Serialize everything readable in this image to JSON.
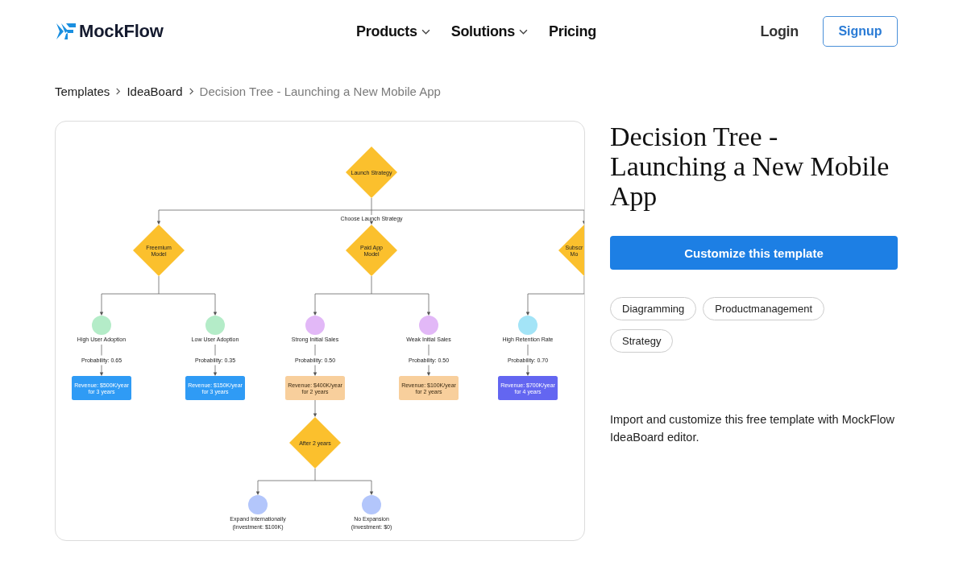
{
  "header": {
    "logo": "MockFlow",
    "nav": [
      {
        "label": "Products",
        "dropdown": true
      },
      {
        "label": "Solutions",
        "dropdown": true
      },
      {
        "label": "Pricing",
        "dropdown": false
      }
    ],
    "login": "Login",
    "signup": "Signup"
  },
  "breadcrumb": [
    {
      "label": "Templates",
      "current": false
    },
    {
      "label": "IdeaBoard",
      "current": false
    },
    {
      "label": "Decision Tree - Launching a New Mobile App",
      "current": true
    }
  ],
  "preview": {
    "diagram": {
      "kind": "decision",
      "lines": [
        "Launch Strategy"
      ],
      "edge_label": "Choose Launch Strategy",
      "children": [
        {
          "kind": "decision",
          "lines": [
            "Freemium",
            "Model"
          ],
          "children": [
            {
              "kind": "chance",
              "color": "#b4ecc8",
              "lines": [
                "High User Adoption"
              ],
              "edge_label": "Probability: 0.65",
              "children": [
                {
                  "kind": "outcome",
                  "color": "#2f9bf5",
                  "lines": [
                    "Revenue: $500K/year",
                    "for 3 years"
                  ]
                }
              ]
            },
            {
              "kind": "chance",
              "color": "#b4ecc8",
              "lines": [
                "Low User Adoption"
              ],
              "edge_label": "Probability: 0.35",
              "children": [
                {
                  "kind": "outcome",
                  "color": "#2f9bf5",
                  "lines": [
                    "Revenue: $150K/year",
                    "for 3 years"
                  ]
                }
              ]
            }
          ]
        },
        {
          "kind": "decision",
          "lines": [
            "Paid App",
            "Model"
          ],
          "children": [
            {
              "kind": "chance",
              "color": "#e2b8f7",
              "lines": [
                "Strong Initial Sales"
              ],
              "edge_label": "Probability: 0.50",
              "children": [
                {
                  "kind": "outcome",
                  "color": "#f8cf9c",
                  "lines": [
                    "Revenue: $400K/year",
                    "for 2 years"
                  ],
                  "children": [
                    {
                      "kind": "decision",
                      "lines": [
                        "After 2 years"
                      ],
                      "children": [
                        {
                          "kind": "chance",
                          "color": "#b3c6fb",
                          "lines": [
                            "Expand Internationally",
                            "(Investment: $100K)"
                          ]
                        },
                        {
                          "kind": "chance",
                          "color": "#b3c6fb",
                          "lines": [
                            "No Expansion",
                            "(Investment: $0)"
                          ]
                        }
                      ]
                    }
                  ]
                }
              ]
            },
            {
              "kind": "chance",
              "color": "#e2b8f7",
              "lines": [
                "Weak Initial Sales"
              ],
              "edge_label": "Probability: 0.50",
              "children": [
                {
                  "kind": "outcome",
                  "color": "#f8cf9c",
                  "lines": [
                    "Revenue: $100K/year",
                    "for 2 years"
                  ]
                }
              ]
            }
          ]
        },
        {
          "kind": "decision",
          "lines": [
            "Subscr",
            "Mo"
          ],
          "children": [
            {
              "kind": "chance",
              "color": "#a3e4f7",
              "lines": [
                "High Retention Rate"
              ],
              "edge_label": "Probability: 0.70",
              "children": [
                {
                  "kind": "outcome",
                  "color": "#6366f1",
                  "lines": [
                    "Revenue: $700K/year",
                    "for 4 years"
                  ]
                }
              ]
            }
          ]
        }
      ]
    }
  },
  "details": {
    "title": "Decision Tree - Launching a New Mobile App",
    "button": "Customize this template",
    "tags": [
      "Diagramming",
      "Productmanagement",
      "Strategy"
    ],
    "description": "Import and customize this free template with MockFlow IdeaBoard editor."
  }
}
